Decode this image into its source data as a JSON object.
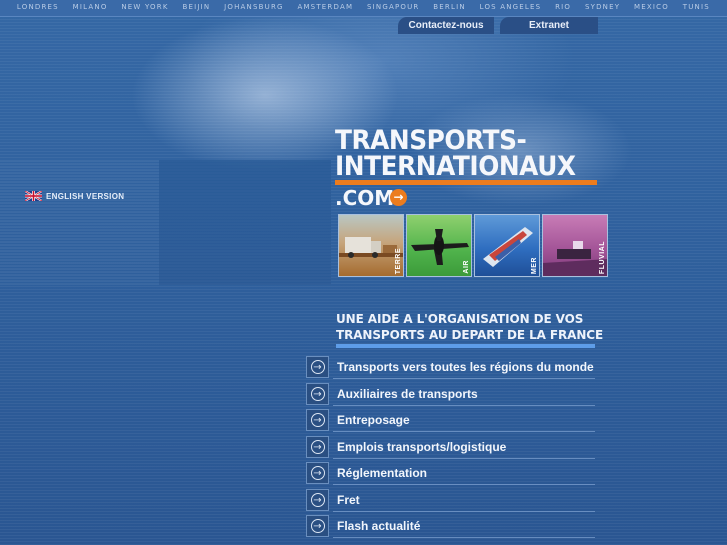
{
  "top_cities": [
    "LONDRES",
    "MILANO",
    "NEW YORK",
    "BEIJIN",
    "JOHANSBURG",
    "AMSTERDAM",
    "SINGAPOUR",
    "BERLIN",
    "LOS ANGELES",
    "RIO",
    "SYDNEY",
    "MEXICO",
    "TUNIS"
  ],
  "tabs": {
    "contact": "Contactez-nous",
    "extranet": "Extranet"
  },
  "language": {
    "label": "ENGLISH VERSION",
    "icon": "uk-flag-icon"
  },
  "logo": {
    "line1": "TRANSPORTS-",
    "line2": "INTERNATIONAUX",
    "line3": ".COM",
    "accent": "#ec7c1e"
  },
  "photos": [
    {
      "label": "TERRE"
    },
    {
      "label": "AIR"
    },
    {
      "label": "MER"
    },
    {
      "label": "FLUVIAL"
    }
  ],
  "heading": {
    "line1": "UNE AIDE A L'ORGANISATION DE VOS",
    "line2": "TRANSPORTS AU DEPART DE LA FRANCE"
  },
  "menu": [
    {
      "label": "Transports vers toutes les régions du monde"
    },
    {
      "label": "Auxiliaires de transports"
    },
    {
      "label": "Entreposage"
    },
    {
      "label": "Emplois transports/logistique"
    },
    {
      "label": "Réglementation"
    },
    {
      "label": "Fret"
    },
    {
      "label": "Flash actualité"
    }
  ]
}
